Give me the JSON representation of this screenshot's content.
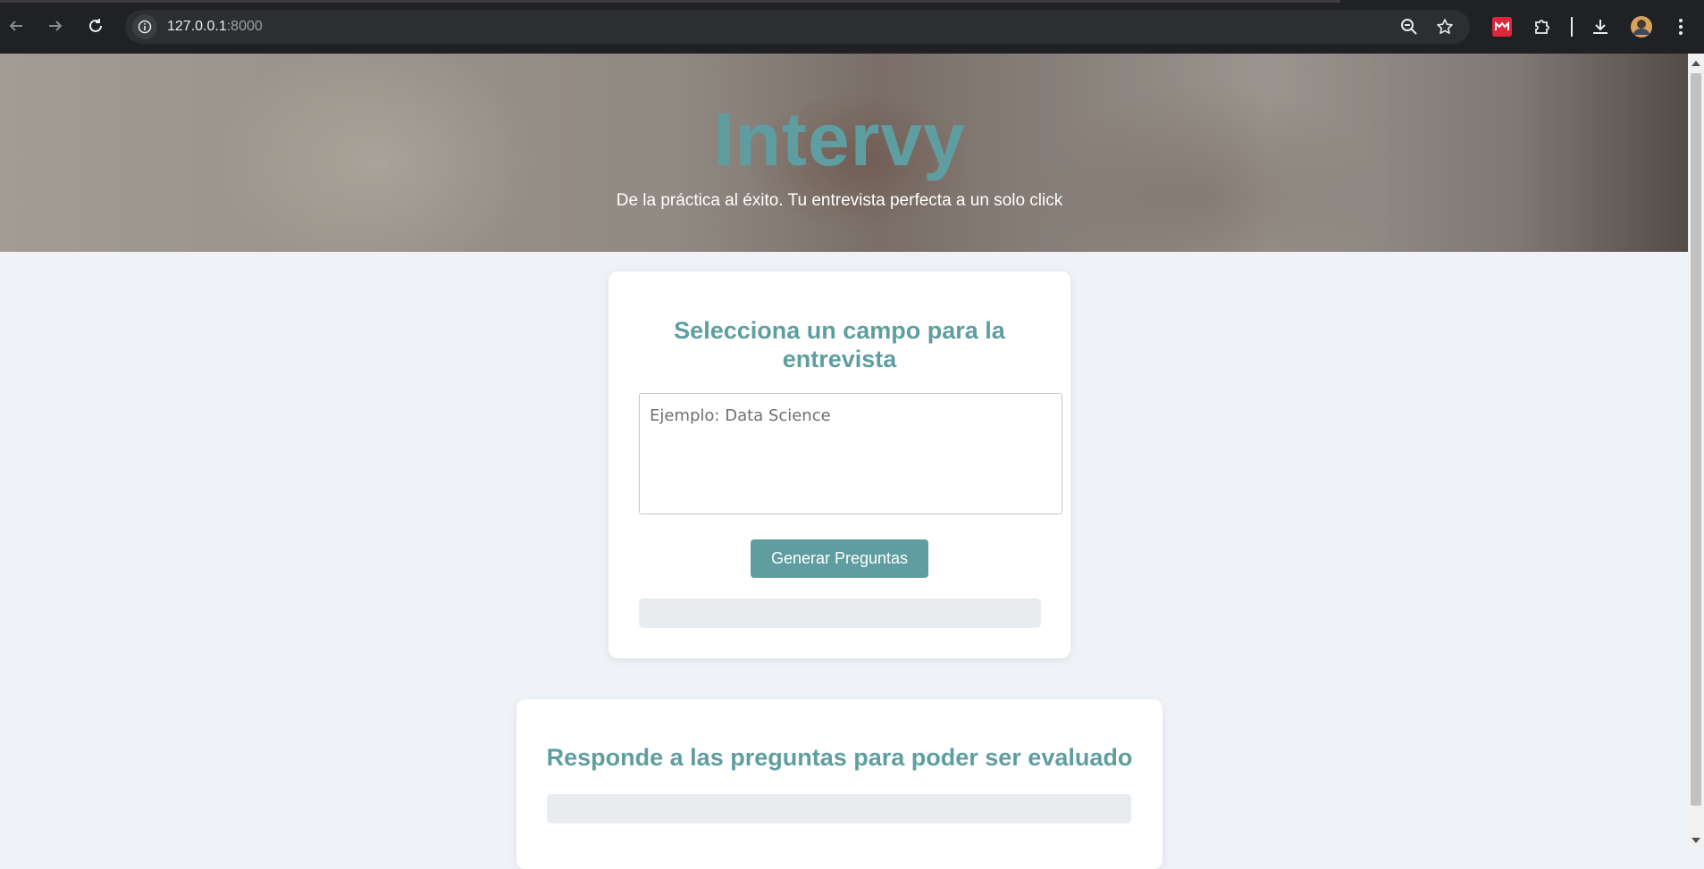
{
  "browser": {
    "url_host": "127.0.0.1",
    "url_port": ":8000"
  },
  "hero": {
    "title": "Intervy",
    "subtitle": "De la práctica al éxito. Tu entrevista perfecta a un solo click"
  },
  "field_card": {
    "title": "Selecciona un campo para la entrevista",
    "placeholder": "Ejemplo: Data Science",
    "button": "Generar Preguntas"
  },
  "questions_card": {
    "title": "Responde a las preguntas para poder ser evaluado"
  },
  "colors": {
    "accent": "#5f9ea0",
    "page_bg": "#eff2f7"
  }
}
